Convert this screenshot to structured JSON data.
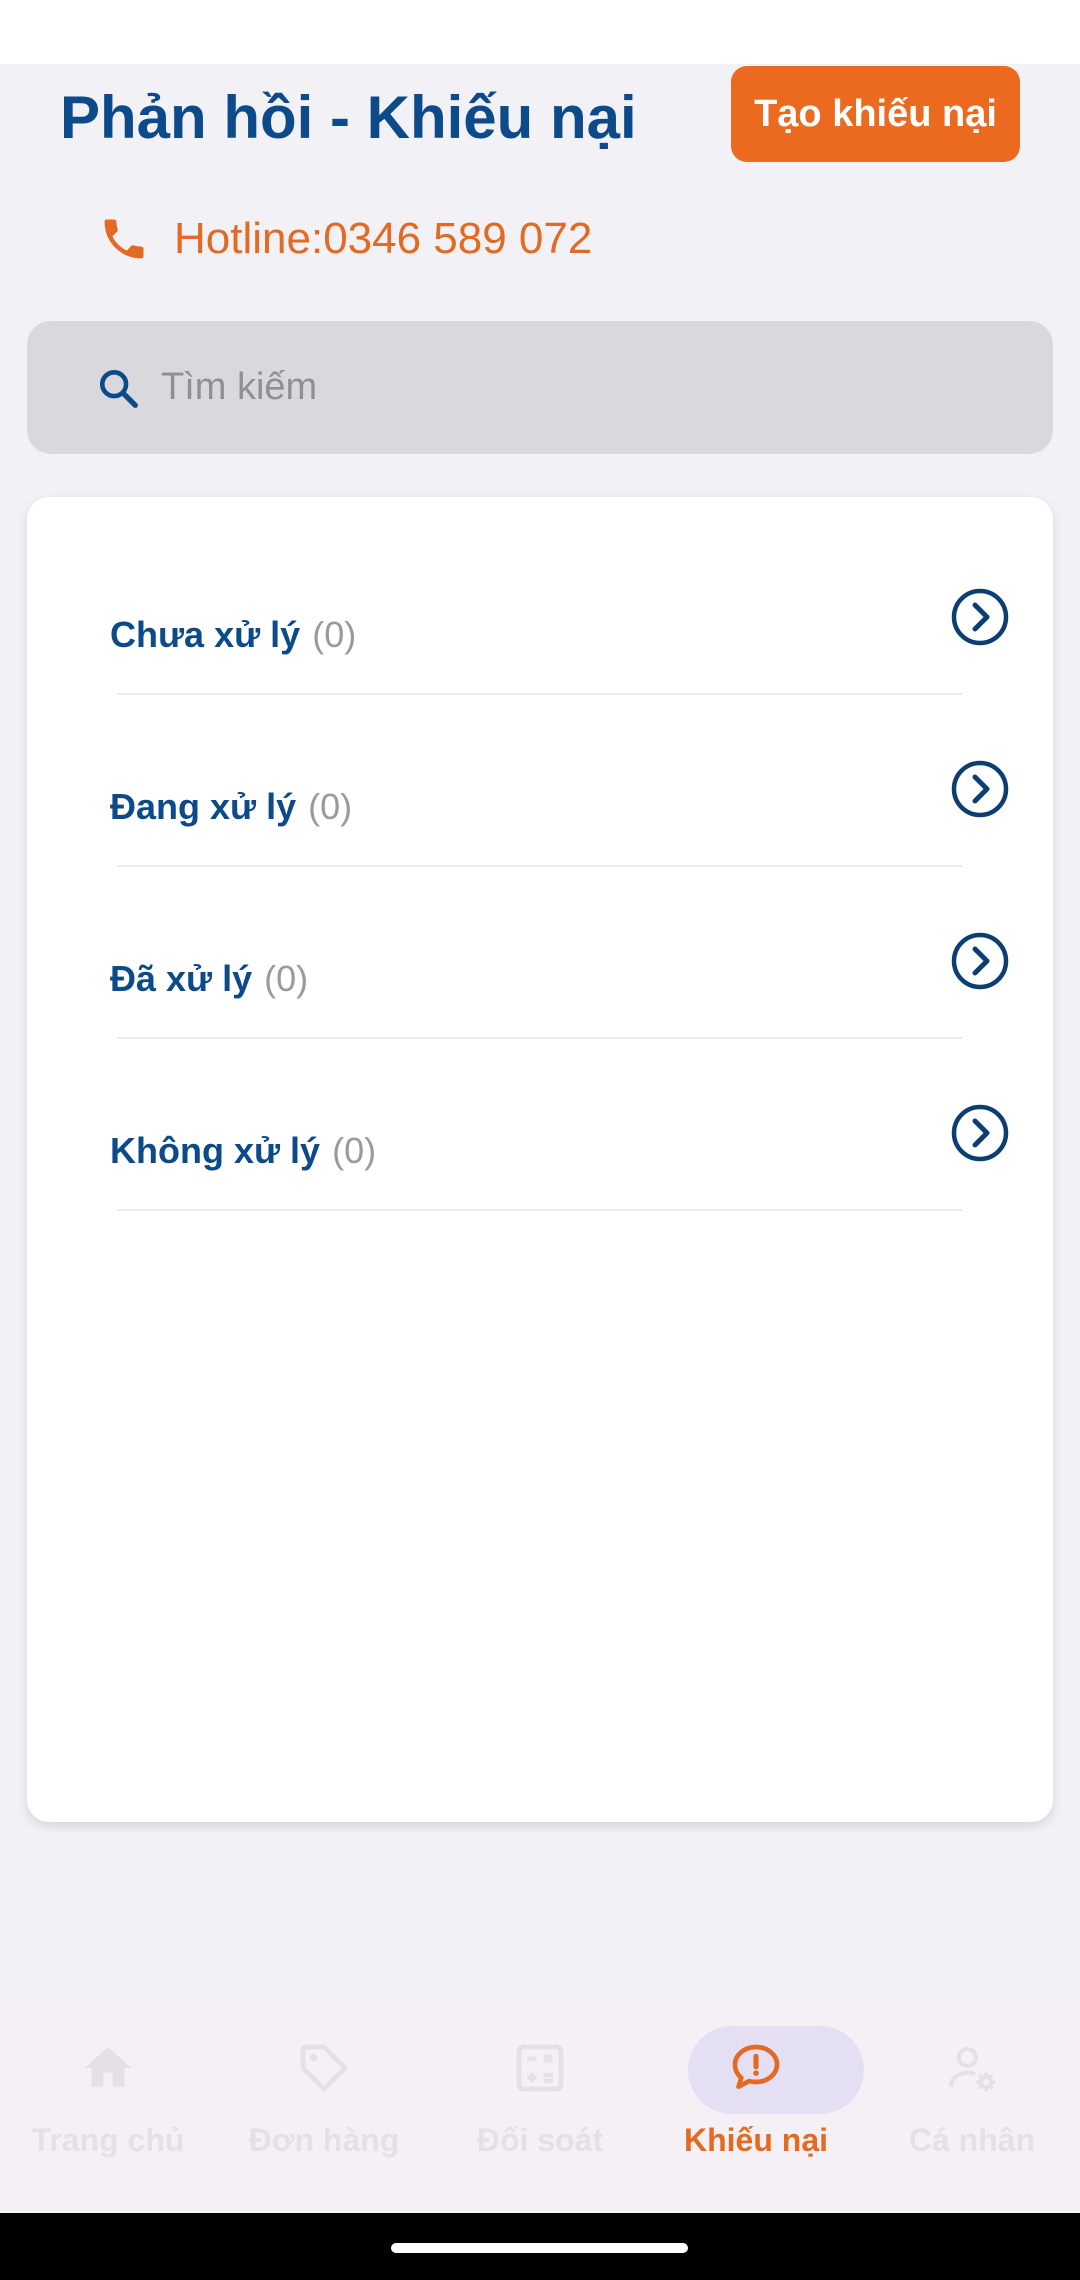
{
  "header": {
    "title": "Phản hồi - Khiếu nại",
    "create_button_label": "Tạo khiếu nại",
    "hotline": "Hotline:0346 589 072"
  },
  "search": {
    "placeholder": "Tìm kiếm",
    "value": ""
  },
  "status_list": [
    {
      "label": "Chưa xử lý",
      "count": "(0)",
      "icon": "chevron-right-circle-icon"
    },
    {
      "label": "Đang xử lý",
      "count": "(0)",
      "icon": "chevron-right-circle-icon"
    },
    {
      "label": "Đã xử lý",
      "count": "(0)",
      "icon": "chevron-right-circle-icon"
    },
    {
      "label": "Không xử lý",
      "count": "(0)",
      "icon": "chevron-right-circle-icon"
    }
  ],
  "bottom_nav": {
    "active_index": 3,
    "items": [
      {
        "label": "Trang chủ",
        "icon": "home-icon"
      },
      {
        "label": "Đơn hàng",
        "icon": "tag-icon"
      },
      {
        "label": "Đối soát",
        "icon": "calculator-icon"
      },
      {
        "label": "Khiếu nại",
        "icon": "complaint-chat-icon"
      },
      {
        "label": "Cá nhân",
        "icon": "user-settings-icon"
      }
    ]
  },
  "colors": {
    "brand_blue": "#0c4a8a",
    "accent_orange": "#ec6a1f",
    "background": "#f2f1f6",
    "active_nav_pill": "#e5dff4"
  }
}
